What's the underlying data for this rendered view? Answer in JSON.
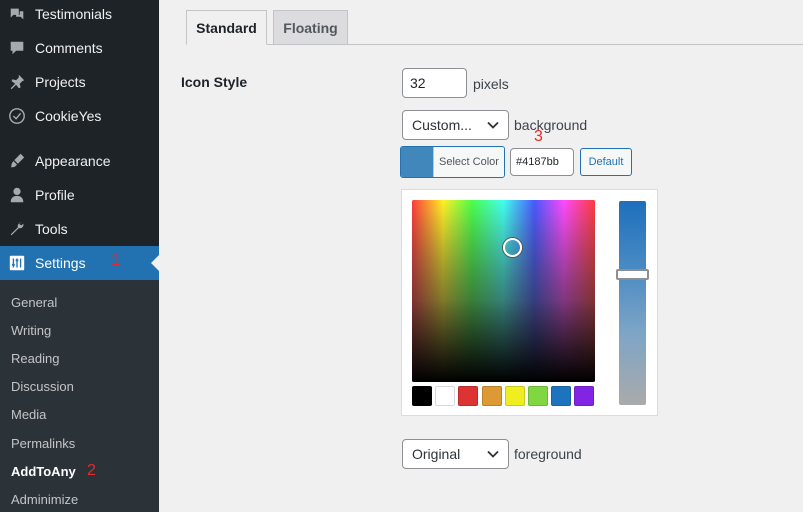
{
  "sidebar": {
    "items": [
      {
        "label": "Testimonials",
        "icon": "testimonials-icon"
      },
      {
        "label": "Comments",
        "icon": "comment-icon"
      },
      {
        "label": "Projects",
        "icon": "pin-icon"
      },
      {
        "label": "CookieYes",
        "icon": "cookie-icon"
      },
      {
        "label": "Appearance",
        "icon": "brush-icon"
      },
      {
        "label": "Profile",
        "icon": "user-icon"
      },
      {
        "label": "Tools",
        "icon": "wrench-icon"
      },
      {
        "label": "Settings",
        "icon": "settings-icon"
      }
    ],
    "submenu": [
      "General",
      "Writing",
      "Reading",
      "Discussion",
      "Media",
      "Permalinks",
      "AddToAny",
      "Adminimize"
    ],
    "active_item": "Settings",
    "current_sub": "AddToAny"
  },
  "annotations": [
    "1",
    "2",
    "3"
  ],
  "tabs": [
    {
      "label": "Standard",
      "active": true
    },
    {
      "label": "Floating",
      "active": false
    }
  ],
  "icon_style": {
    "label": "Icon Style",
    "size_value": "32",
    "size_unit": "pixels",
    "background_select": "Custom...",
    "background_label": "background",
    "select_color_label": "Select Color",
    "hex_value": "#4187bb",
    "default_label": "Default",
    "foreground_select": "Original",
    "foreground_label": "foreground"
  },
  "colors": {
    "accent": "#2271b1",
    "current_color": "#4187bb",
    "sidebar_bg": "#1d2327",
    "palette": [
      "#000000",
      "#ffffff",
      "#dd3333",
      "#dd9933",
      "#eeee22",
      "#81d742",
      "#1e73be",
      "#8224e3"
    ]
  },
  "picker": {
    "handle_saturation": 0.55,
    "handle_value": 0.74,
    "slider_level": 0.36
  }
}
